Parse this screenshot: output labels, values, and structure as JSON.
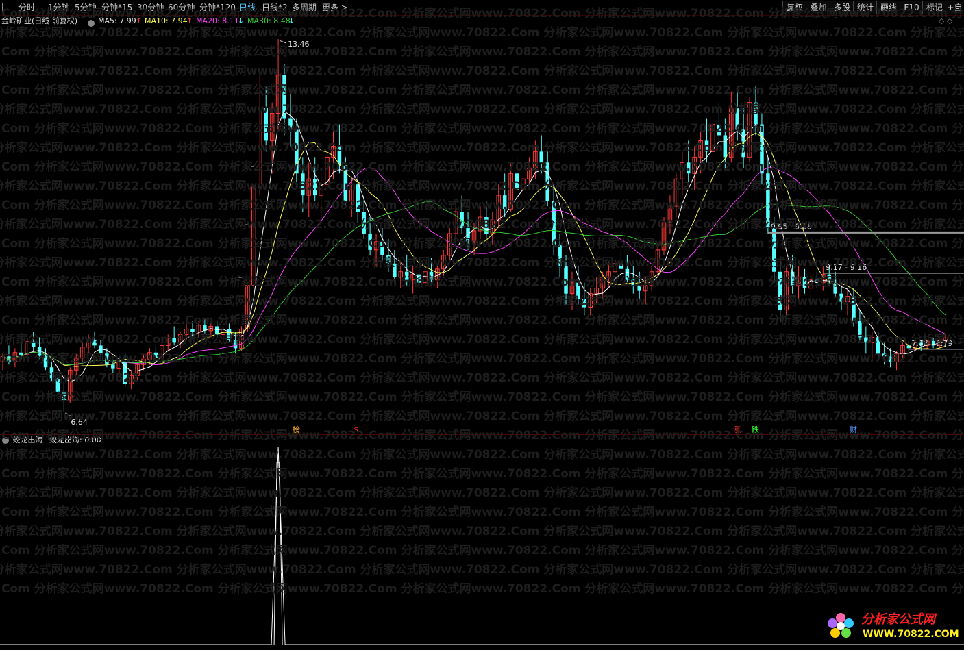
{
  "toolbar": {
    "periods": [
      "分时",
      "1分钟",
      "5分钟",
      "分钟*15",
      "30分钟",
      "60分钟",
      "分钟*120",
      "日线",
      "日线*2",
      "多周期",
      "更多 >"
    ],
    "active": "日线",
    "right_buttons": [
      "复权",
      "叠加",
      "多股",
      "统计",
      "画线",
      "F10",
      "标记",
      "+自"
    ]
  },
  "ma_row": {
    "title": "金岭矿业(日线 前复权)",
    "ma5": "MA5: 7.99",
    "ma5_arrow": "↑",
    "ma10": "MA10: 7.94",
    "ma10_arrow": "↑",
    "ma20": "MA20: 8.11",
    "ma20_arrow": "↓",
    "ma30": "MA30: 8.48",
    "ma30_arrow": "↓",
    "right_icons": "◇ ◇"
  },
  "price_annotations": {
    "high": "13.46",
    "low": "6.64",
    "range1": "9.95 - 9.88",
    "range2": "9.17 - 9.16",
    "range3": "7.78 - 7.79"
  },
  "event_markers": [
    "榜",
    "$",
    "涨",
    "跌",
    "财"
  ],
  "indicator": {
    "name": "蛟龙出海",
    "value_label": "蛟龙出海: 0.00"
  },
  "watermark": {
    "row_text": "Com     分析家公式网www.70822.Com     分析家公式网www.70822.Com     分析家公式网www.70822.Com     分析家公式网www.70822.Com     分析家公式网www.70822.Com     分析家公式网www.70822.Com"
  },
  "logo": {
    "title": "分析家公式网",
    "url": "WWW.70822.COM"
  },
  "colors": {
    "up": "#ff3b3b",
    "down": "#54ffff",
    "ma5": "#ffffff",
    "ma10": "#ffff55",
    "ma20": "#ff40ff",
    "ma30": "#33cc33",
    "active_tab": "#55c8ff"
  },
  "chart_data": {
    "type": "candlestick",
    "ylim": [
      6.5,
      13.6
    ],
    "ohlc": [
      [
        7.55,
        7.7,
        7.4,
        7.65
      ],
      [
        7.65,
        7.85,
        7.5,
        7.55
      ],
      [
        7.55,
        7.8,
        7.45,
        7.72
      ],
      [
        7.72,
        7.9,
        7.6,
        7.68
      ],
      [
        7.68,
        8.0,
        7.55,
        7.92
      ],
      [
        7.92,
        8.1,
        7.75,
        7.82
      ],
      [
        7.82,
        8.0,
        7.6,
        7.66
      ],
      [
        7.66,
        7.8,
        7.4,
        7.45
      ],
      [
        7.45,
        7.6,
        7.2,
        7.25
      ],
      [
        7.25,
        7.35,
        6.95,
        7.0
      ],
      [
        7.0,
        7.2,
        6.64,
        6.85
      ],
      [
        6.85,
        7.45,
        6.8,
        7.4
      ],
      [
        7.4,
        7.7,
        7.3,
        7.62
      ],
      [
        7.62,
        7.9,
        7.5,
        7.82
      ],
      [
        7.82,
        8.05,
        7.7,
        7.95
      ],
      [
        7.95,
        8.1,
        7.8,
        7.85
      ],
      [
        7.85,
        7.95,
        7.6,
        7.7
      ],
      [
        7.7,
        7.8,
        7.45,
        7.5
      ],
      [
        7.5,
        7.65,
        7.35,
        7.42
      ],
      [
        7.42,
        7.6,
        7.3,
        7.55
      ],
      [
        7.55,
        7.7,
        7.1,
        7.15
      ],
      [
        7.15,
        7.4,
        7.05,
        7.3
      ],
      [
        7.3,
        7.55,
        7.2,
        7.5
      ],
      [
        7.5,
        7.7,
        7.4,
        7.6
      ],
      [
        7.6,
        7.8,
        7.5,
        7.72
      ],
      [
        7.72,
        7.85,
        7.55,
        7.62
      ],
      [
        7.62,
        7.9,
        7.55,
        7.85
      ],
      [
        7.85,
        8.05,
        7.75,
        7.98
      ],
      [
        7.98,
        8.2,
        7.85,
        7.9
      ],
      [
        7.9,
        8.1,
        7.8,
        8.05
      ],
      [
        8.05,
        8.25,
        7.95,
        8.15
      ],
      [
        8.15,
        8.3,
        8.0,
        8.1
      ],
      [
        8.1,
        8.3,
        8.0,
        8.22
      ],
      [
        8.22,
        8.35,
        8.05,
        8.12
      ],
      [
        8.12,
        8.28,
        8.0,
        8.2
      ],
      [
        8.2,
        8.3,
        8.0,
        8.05
      ],
      [
        8.05,
        8.2,
        7.9,
        8.15
      ],
      [
        8.15,
        8.25,
        7.9,
        7.95
      ],
      [
        7.95,
        8.1,
        7.7,
        7.8
      ],
      [
        7.8,
        8.2,
        7.75,
        8.15
      ],
      [
        8.15,
        9.0,
        8.1,
        8.95
      ],
      [
        8.95,
        10.8,
        8.9,
        10.75
      ],
      [
        10.75,
        12.8,
        10.6,
        12.2
      ],
      [
        12.2,
        12.6,
        11.4,
        11.6
      ],
      [
        11.6,
        12.3,
        11.0,
        12.1
      ],
      [
        12.1,
        13.46,
        11.8,
        12.8
      ],
      [
        12.8,
        13.0,
        11.7,
        12.0
      ],
      [
        12.0,
        12.5,
        11.5,
        11.8
      ],
      [
        11.8,
        12.0,
        10.8,
        11.0
      ],
      [
        11.0,
        11.3,
        10.3,
        10.6
      ],
      [
        10.6,
        11.2,
        10.2,
        10.9
      ],
      [
        10.9,
        11.3,
        10.5,
        10.6
      ],
      [
        10.6,
        11.0,
        10.2,
        10.8
      ],
      [
        10.8,
        11.5,
        10.6,
        11.3
      ],
      [
        11.3,
        11.8,
        10.9,
        11.5
      ],
      [
        11.5,
        11.9,
        11.0,
        11.15
      ],
      [
        11.15,
        11.3,
        10.4,
        10.5
      ],
      [
        10.5,
        10.9,
        10.2,
        10.8
      ],
      [
        10.8,
        11.1,
        10.1,
        10.3
      ],
      [
        10.3,
        10.6,
        9.8,
        9.9
      ],
      [
        9.9,
        10.2,
        9.5,
        9.6
      ],
      [
        9.6,
        9.9,
        9.3,
        9.75
      ],
      [
        9.75,
        10.0,
        9.4,
        9.5
      ],
      [
        9.5,
        9.8,
        9.2,
        9.35
      ],
      [
        9.35,
        9.6,
        9.0,
        9.1
      ],
      [
        9.1,
        9.4,
        8.9,
        9.2
      ],
      [
        9.2,
        9.5,
        8.95,
        9.05
      ],
      [
        9.05,
        9.3,
        8.8,
        9.15
      ],
      [
        9.15,
        9.4,
        8.9,
        9.0
      ],
      [
        9.0,
        9.3,
        8.85,
        9.2
      ],
      [
        9.2,
        9.45,
        8.95,
        9.05
      ],
      [
        9.05,
        9.35,
        8.9,
        9.25
      ],
      [
        9.25,
        9.6,
        9.1,
        9.5
      ],
      [
        9.5,
        10.0,
        9.4,
        9.9
      ],
      [
        9.9,
        10.5,
        9.7,
        10.3
      ],
      [
        10.3,
        10.6,
        9.9,
        10.0
      ],
      [
        10.0,
        10.3,
        9.6,
        9.75
      ],
      [
        9.75,
        10.1,
        9.5,
        9.95
      ],
      [
        9.95,
        10.4,
        9.8,
        10.2
      ],
      [
        10.2,
        10.5,
        9.8,
        9.9
      ],
      [
        9.9,
        10.3,
        9.7,
        10.15
      ],
      [
        10.15,
        10.8,
        10.0,
        10.6
      ],
      [
        10.6,
        11.0,
        10.2,
        10.35
      ],
      [
        10.35,
        11.2,
        10.3,
        11.0
      ],
      [
        11.0,
        11.3,
        10.5,
        10.7
      ],
      [
        10.7,
        11.1,
        10.5,
        10.9
      ],
      [
        10.9,
        11.3,
        10.7,
        11.1
      ],
      [
        11.1,
        11.6,
        10.9,
        11.4
      ],
      [
        11.4,
        11.7,
        11.0,
        11.2
      ],
      [
        11.2,
        11.4,
        10.4,
        10.5
      ],
      [
        10.5,
        10.8,
        9.5,
        9.7
      ],
      [
        9.7,
        9.9,
        9.1,
        9.3
      ],
      [
        9.3,
        9.5,
        8.6,
        8.8
      ],
      [
        8.8,
        9.2,
        8.5,
        9.0
      ],
      [
        9.0,
        9.3,
        8.6,
        8.7
      ],
      [
        8.7,
        9.0,
        8.4,
        8.55
      ],
      [
        8.55,
        8.9,
        8.4,
        8.8
      ],
      [
        8.8,
        9.1,
        8.6,
        8.9
      ],
      [
        8.9,
        9.2,
        8.7,
        9.1
      ],
      [
        9.1,
        9.4,
        8.9,
        9.2
      ],
      [
        9.2,
        9.5,
        9.0,
        9.35
      ],
      [
        9.35,
        9.6,
        9.1,
        9.25
      ],
      [
        9.25,
        9.5,
        9.0,
        9.05
      ],
      [
        9.05,
        9.3,
        8.8,
        8.95
      ],
      [
        8.95,
        9.2,
        8.7,
        8.85
      ],
      [
        8.85,
        9.1,
        8.6,
        8.95
      ],
      [
        8.95,
        9.3,
        8.85,
        9.2
      ],
      [
        9.2,
        9.7,
        9.1,
        9.6
      ],
      [
        9.6,
        10.2,
        9.5,
        10.1
      ],
      [
        10.1,
        10.6,
        9.9,
        10.4
      ],
      [
        10.4,
        11.0,
        10.2,
        10.9
      ],
      [
        10.9,
        11.4,
        10.6,
        11.2
      ],
      [
        11.2,
        11.6,
        10.8,
        11.0
      ],
      [
        11.0,
        11.5,
        10.7,
        11.3
      ],
      [
        11.3,
        11.8,
        11.0,
        11.6
      ],
      [
        11.6,
        12.0,
        11.2,
        11.4
      ],
      [
        11.4,
        12.1,
        11.3,
        11.9
      ],
      [
        11.9,
        12.3,
        11.5,
        11.7
      ],
      [
        11.7,
        12.0,
        11.1,
        11.3
      ],
      [
        11.3,
        12.5,
        11.2,
        12.2
      ],
      [
        12.2,
        12.6,
        11.6,
        11.8
      ],
      [
        11.8,
        12.2,
        11.1,
        11.3
      ],
      [
        11.3,
        12.4,
        11.2,
        12.3
      ],
      [
        12.3,
        12.6,
        11.7,
        11.9
      ],
      [
        11.9,
        12.1,
        10.8,
        11.0
      ],
      [
        11.0,
        11.3,
        9.9,
        10.0
      ],
      [
        10.0,
        10.2,
        9.0,
        9.2
      ],
      [
        9.2,
        9.4,
        8.3,
        8.5
      ],
      [
        8.5,
        9.3,
        8.4,
        9.2
      ],
      [
        9.2,
        9.5,
        8.8,
        8.95
      ],
      [
        8.95,
        9.3,
        8.7,
        9.1
      ],
      [
        9.1,
        9.25,
        8.8,
        8.9
      ],
      [
        8.9,
        9.2,
        8.7,
        9.05
      ],
      [
        9.05,
        9.2,
        8.9,
        9.0
      ],
      [
        9.0,
        9.3,
        8.85,
        9.15
      ],
      [
        9.15,
        9.3,
        8.95,
        9.05
      ],
      [
        9.05,
        9.2,
        8.75,
        8.8
      ],
      [
        8.8,
        9.0,
        8.5,
        8.65
      ],
      [
        8.65,
        8.9,
        8.4,
        8.75
      ],
      [
        8.75,
        8.9,
        8.2,
        8.3
      ],
      [
        8.3,
        8.5,
        7.9,
        8.0
      ],
      [
        8.0,
        8.2,
        7.7,
        7.9
      ],
      [
        7.9,
        8.1,
        7.6,
        8.0
      ],
      [
        8.0,
        8.1,
        7.6,
        7.7
      ],
      [
        7.7,
        7.9,
        7.5,
        7.65
      ],
      [
        7.65,
        7.8,
        7.45,
        7.55
      ],
      [
        7.55,
        7.75,
        7.4,
        7.7
      ],
      [
        7.7,
        7.9,
        7.6,
        7.85
      ],
      [
        7.85,
        7.95,
        7.7,
        7.8
      ],
      [
        7.8,
        7.95,
        7.7,
        7.9
      ],
      [
        7.9,
        7.95,
        7.75,
        7.85
      ],
      [
        7.85,
        7.95,
        7.78,
        7.93
      ],
      [
        7.93,
        8.0,
        7.8,
        7.85
      ],
      [
        7.85,
        7.98,
        7.8,
        7.95
      ],
      [
        7.95,
        8.05,
        7.85,
        7.99
      ]
    ],
    "indicator_peak_index": 45
  }
}
